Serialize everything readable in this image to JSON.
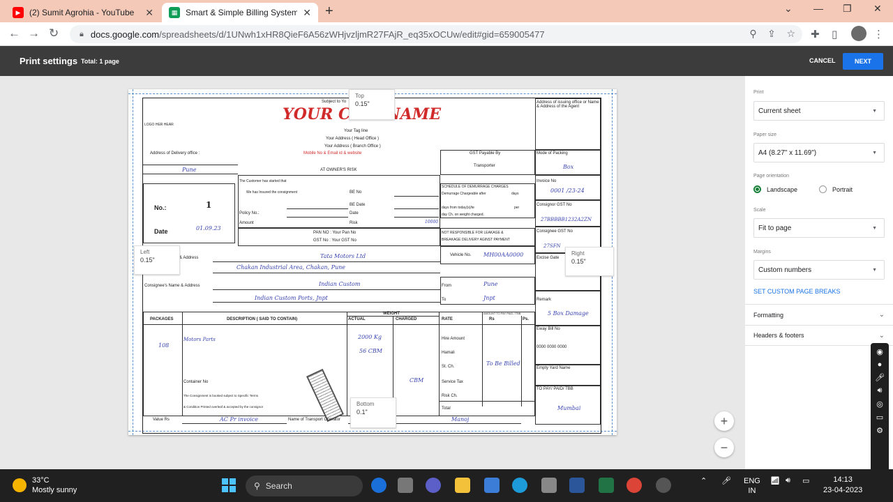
{
  "browser": {
    "tabs": [
      {
        "label": "(2) Sumit Agrohia - YouTube",
        "icon": "youtube-icon",
        "color": "#ff0000"
      },
      {
        "label": "Smart & Simple Billing System - ",
        "icon": "sheets-icon",
        "color": "#0f9d58"
      }
    ],
    "url_host": "docs.google.com",
    "url_path": "/spreadsheets/d/1UNwh1xHR8QieF6A56zWHjvzljmR27FAjR_eq35xOCUw/edit#gid=659005477"
  },
  "print": {
    "title": "Print settings",
    "total": "Total: 1 page",
    "cancel": "CANCEL",
    "next": "NEXT",
    "accent": "#1a73e8"
  },
  "margins": {
    "top_label": "Top",
    "top_value": "0.15\"",
    "left_label": "Left",
    "left_value": "0.15\"",
    "right_label": "Right",
    "right_value": "0.15\"",
    "bottom_label": "Bottom",
    "bottom_value": "0.1\""
  },
  "panel": {
    "print_label": "Print",
    "print_value": "Current sheet",
    "paper_label": "Paper size",
    "paper_value": "A4 (8.27\" x 11.69\")",
    "orientation_label": "Page orientation",
    "landscape": "Landscape",
    "portrait": "Portrait",
    "scale_label": "Scale",
    "scale_value": "Fit to page",
    "margins_label": "Margins",
    "margins_value": "Custom numbers",
    "custom_breaks": "SET CUSTOM PAGE BREAKS",
    "formatting": "Formatting",
    "headers": "Headers & footers"
  },
  "sheet": {
    "subject": "Subject to Yo",
    "company": "YOUR COM        NAME",
    "logo": "LOGO HER HEAR",
    "tagline": "Your Tag line",
    "head_office": "Your Address ( Head Office )",
    "branch_office": "Your Address ( Branch Office )",
    "contact": "Mobile No & Email id & website",
    "issuing": "Address of issuing office or Name & Address of the Agent",
    "delivery_office": "Address of Delivery office :",
    "delivery_city": "Pune",
    "owners_risk": "AT OWNER'S RISK",
    "gst_payable": "GST Payable By",
    "transporter": "Transporter",
    "mode_packing": "Mode of Packing",
    "mode_value": "Box",
    "invoice_no": "Invoice No",
    "invoice_value": "0001 /23-24",
    "consignor_gst": "Consignor GST No",
    "consignor_gst_value": "27BBBBB1232A2ZN",
    "consignee_gst": "Consignee GST No",
    "consignee_gst_value": "27SFN",
    "excise": "Excise Gate",
    "insured_note": "The Customer has started that",
    "insured2": "We has Insured the consignment",
    "policy_no": "Policy No.:",
    "amount": "Amount",
    "be_no": "BE No",
    "be_date": "BE Date",
    "date_lbl": "Date",
    "risk": "Risk",
    "risk_value": "10000",
    "no_label": "No.:",
    "no_value": "1",
    "date_label": "Date",
    "date_value": "01.09.23",
    "demurrage_title": "SCHEDULE OF DEMURRAGE CHARGES",
    "demurrage1": "Demurrage Chargeable after",
    "demurrage1b": "days",
    "demurrage2": "days from today(s)/te",
    "demurrage2b": "per",
    "demurrage3": "day Ch. on weight charged.",
    "pan": "PAN NO  : Your Pan No",
    "gstno": "GST No  : Your GST No",
    "not_responsible": "NOT RESPONSIBLE FOR LEAKAGE &",
    "breakage": "BREAKAGE DELIVERY AGINST PAYMENT",
    "consignor_address": "& Address",
    "consignor_name": "Tata Motors Ltd",
    "consignor_addr": "Chakan Industrial Area, Chakan, Pune",
    "vehicle_no": "Vehicle No.",
    "vehicle_value": "MH00AA0000",
    "consignee_label": "Consignee's Name & Address",
    "consignee_name": "Indian Custom",
    "consignee_addr": "Indian Custom Ports, Jnpt",
    "from": "From",
    "from_value": "Pune",
    "to": "To",
    "to_value": "Jnpt",
    "remark": "Remark",
    "remark_value": "5 Box Damage",
    "packages": "PACKAGES",
    "description": "DESCRIPTION ( SAID TO CONTAIN)",
    "weight": "WEIGHT",
    "actual": "ACTUAL",
    "charged": "CHARGED",
    "rate": "RATE",
    "amount_pay": "AMOUNT TO PAY PAID / TBB",
    "rs": "Rs",
    "ps": "Ps.",
    "pkg_value": "108",
    "desc_value": "Motors Parts",
    "actual_value": "2000 Kg",
    "cbm_value": "56 CBM",
    "charged_value": "CBM",
    "hire": "Hire Amount",
    "hamali": "Hamali",
    "stch": "St. Ch.",
    "service_tax": "Service Tax",
    "riskch": "Risk Ch.",
    "total": "Total",
    "tbb_value": "To Be Billed",
    "container": "Container No",
    "terms1": "The Consignment is booked subject to Specific Terms",
    "terms2": "& Condition Printed overleaf & accepted by the consignor",
    "eway": "Eway Bill No",
    "eway_value": "0000 0000 0000",
    "empty_yard": "Empty Yard Name",
    "topay": "TO PAY/ PAID/ TBB",
    "topay_value": "Mumbai",
    "value_rs": "Value Rs",
    "value_value": "AC Pr invoice",
    "transport_op": "Name of Transport Operator",
    "operator_value": "Manoj"
  },
  "taskbar": {
    "temp": "33°C",
    "weather": "Mostly sunny",
    "search": "Search",
    "lang1": "ENG",
    "lang2": "IN",
    "time": "14:13",
    "date": "23-04-2023"
  }
}
